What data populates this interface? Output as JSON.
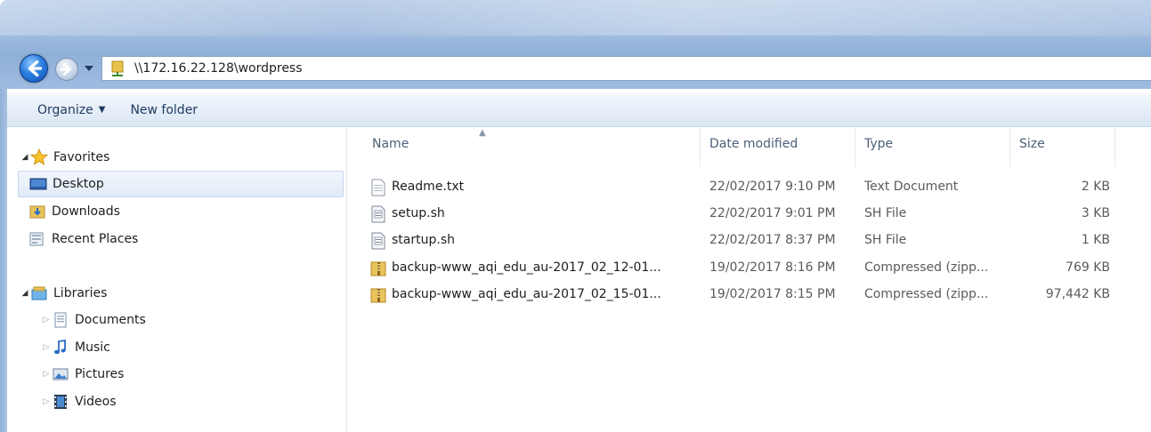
{
  "address": {
    "path": "\\\\172.16.22.128\\wordpress"
  },
  "toolbar": {
    "organize": "Organize",
    "new_folder": "New folder"
  },
  "nav": {
    "favorites": {
      "label": "Favorites",
      "items": [
        {
          "label": "Desktop",
          "icon": "desktop-icon"
        },
        {
          "label": "Downloads",
          "icon": "downloads-folder-icon"
        },
        {
          "label": "Recent Places",
          "icon": "recent-places-icon"
        }
      ]
    },
    "libraries": {
      "label": "Libraries",
      "items": [
        {
          "label": "Documents",
          "icon": "documents-icon"
        },
        {
          "label": "Music",
          "icon": "music-icon"
        },
        {
          "label": "Pictures",
          "icon": "pictures-icon"
        },
        {
          "label": "Videos",
          "icon": "videos-icon"
        }
      ]
    }
  },
  "columns": {
    "name": "Name",
    "date": "Date modified",
    "type": "Type",
    "size": "Size"
  },
  "files": [
    {
      "name": "Readme.txt",
      "date": "22/02/2017 9:10 PM",
      "type": "Text Document",
      "size": "2 KB",
      "icon": "text-file-icon"
    },
    {
      "name": "setup.sh",
      "date": "22/02/2017 9:01 PM",
      "type": "SH File",
      "size": "3 KB",
      "icon": "script-file-icon"
    },
    {
      "name": "startup.sh",
      "date": "22/02/2017 8:37 PM",
      "type": "SH File",
      "size": "1 KB",
      "icon": "script-file-icon"
    },
    {
      "name": "backup-www_aqi_edu_au-2017_02_12-01...",
      "date": "19/02/2017 8:16 PM",
      "type": "Compressed (zipp...",
      "size": "769 KB",
      "icon": "zip-folder-icon"
    },
    {
      "name": "backup-www_aqi_edu_au-2017_02_15-01...",
      "date": "19/02/2017 8:15 PM",
      "type": "Compressed (zipp...",
      "size": "97,442 KB",
      "icon": "zip-folder-icon"
    }
  ],
  "colors": {
    "accent": "#1e3a5f",
    "selection": "#e1ebf7",
    "frame": "#a9c2e2"
  }
}
